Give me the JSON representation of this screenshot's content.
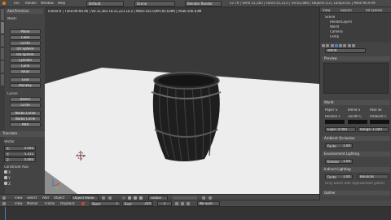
{
  "topbar": {
    "menus": [
      "File",
      "Render",
      "Window",
      "Help"
    ],
    "screen": "Default",
    "scene": "Scene",
    "engine": "Blender Render",
    "stats": "v2.79 | Verts:31,363 | Faces:31,223 | Tris:62,880 | Objects:1/3 | Lamps:0/1 | Mem:90.97M"
  },
  "toolshelf": {
    "header": "Add Primitive",
    "section_mesh": "Mesh:",
    "mesh_items": [
      "Plane",
      "Cube",
      "Circle",
      "UV Sphere",
      "Ico Sphere",
      "Cylinder",
      "Cone",
      "Torus",
      "Grid",
      "Monkey"
    ],
    "section_curve": "Curve:",
    "curve_items": [
      "Bezier",
      "Circle",
      "Nurbs Curve",
      "Nurbs Circle",
      "Path"
    ],
    "tabs": [
      "Tools",
      "Create",
      "Relations",
      "Animation",
      "Physics",
      "Grease Pencil"
    ]
  },
  "operator": {
    "header": "Translate",
    "vector_label": "Vector",
    "x_label": "X:",
    "x_value": "0.000",
    "y_label": "Y:",
    "y_value": "5.311",
    "z_label": "Z:",
    "z_value": "0.000",
    "constraint_label": "Constraint Axis",
    "checks": [
      "X",
      "Y",
      "Z"
    ]
  },
  "viewport": {
    "info": "Frame:4 | Time:00:00.46 | Ve:31,363 Fa:31,223 La:2 | Mem:102.02M (93.02M) | Peak:106.03M",
    "header_buttons": [
      "View",
      "Select",
      "Add",
      "Object"
    ],
    "mode": "Object Mode",
    "pivot": "Global"
  },
  "timeline": {
    "buttons": [
      "View",
      "Marker",
      "Frame",
      "Playback"
    ],
    "start_label": "Start:",
    "start_value": "1",
    "end_label": "End:",
    "end_value": "250",
    "current": "1",
    "sync": "No Sync"
  },
  "outliner": {
    "buttons": [
      "View",
      "Search",
      "All Scenes"
    ],
    "items": [
      "Scene",
      "RenderLayers",
      "World",
      "Camera",
      "Lamp"
    ]
  },
  "properties": {
    "world_field": "World",
    "preview_label": "Preview",
    "world_panel": "World",
    "paper_sky": "Paper S",
    "blend_sky": "Blend S",
    "real_sky": "Real Sk",
    "horizon_label": "Horizon C",
    "zenith_label": "Zenith C",
    "ambient_label": "Ambient C",
    "expo_label": "Expo: 0.000",
    "range_label": "Range: 1.000",
    "panels": [
      "Ambient Occlusion",
      "Environment Lighting",
      "Indirect Lighting",
      "Gather"
    ],
    "factor_label": "Facto",
    "factor_value": "1.00",
    "energy_label": "Energy",
    "energy_value": "1.00",
    "bounces_label": "Bounces",
    "gather_note": "Only works with Approximate gather"
  },
  "colors": {
    "viewport_bg": "#393939",
    "accent": "#4d7fc4"
  }
}
